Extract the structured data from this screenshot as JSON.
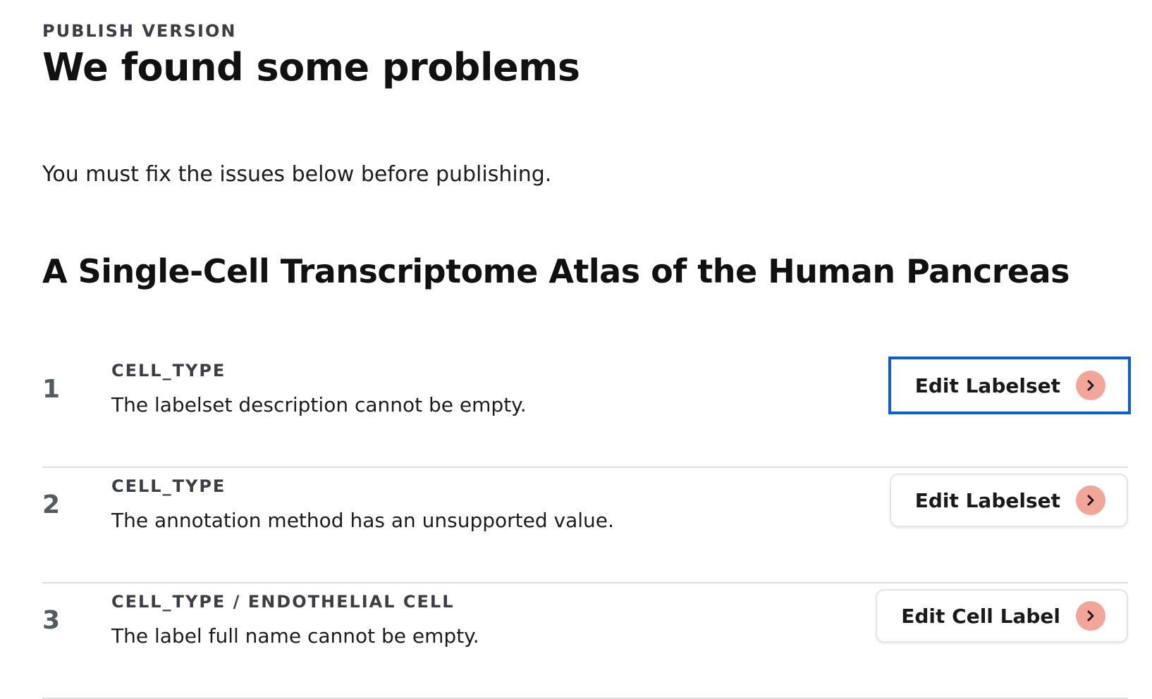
{
  "header": {
    "eyebrow": "PUBLISH VERSION",
    "title": "We found some problems"
  },
  "intro": "You must fix the issues below before publishing.",
  "dataset_title": "A Single-Cell Transcriptome Atlas of the Human Pancreas",
  "issues": [
    {
      "number": "1",
      "path": "CELL_TYPE",
      "message": "The labelset description cannot be empty.",
      "action_label": "Edit Labelset",
      "action_icon": "chevron-right-icon",
      "focused": true
    },
    {
      "number": "2",
      "path": "CELL_TYPE",
      "message": "The annotation method has an unsupported value.",
      "action_label": "Edit Labelset",
      "action_icon": "chevron-right-icon",
      "focused": false
    },
    {
      "number": "3",
      "path": "CELL_TYPE / ENDOTHELIAL CELL",
      "message": "The label full name cannot be empty.",
      "action_label": "Edit Cell Label",
      "action_icon": "chevron-right-icon",
      "focused": false
    }
  ],
  "colors": {
    "focus_ring": "#0b5ed7",
    "icon_circle": "#f2a69a",
    "divider": "#dddddd"
  }
}
